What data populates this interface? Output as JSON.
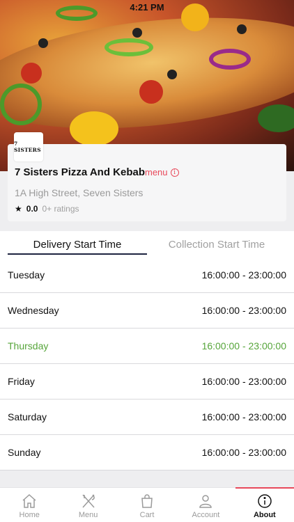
{
  "status_bar": {
    "time": "4:21 PM"
  },
  "restaurant": {
    "logo_text": "7 SISTERS",
    "name": "7 Sisters Pizza And Kebab",
    "menu_link": "menu",
    "address": "1A High Street, Seven Sisters",
    "rating_value": "0.0",
    "rating_count": "0+ ratings"
  },
  "tabs": {
    "delivery": "Delivery Start Time",
    "collection": "Collection Start Time"
  },
  "hours": [
    {
      "day": "Tuesday",
      "time": "16:00:00 - 23:00:00"
    },
    {
      "day": "Wednesday",
      "time": "16:00:00 - 23:00:00"
    },
    {
      "day": "Thursday",
      "time": "16:00:00 - 23:00:00"
    },
    {
      "day": "Friday",
      "time": "16:00:00 - 23:00:00"
    },
    {
      "day": "Saturday",
      "time": "16:00:00 - 23:00:00"
    },
    {
      "day": "Sunday",
      "time": "16:00:00 - 23:00:00"
    }
  ],
  "bottom_nav": {
    "home": "Home",
    "menu": "Menu",
    "cart": "Cart",
    "account": "Account",
    "about": "About"
  },
  "colors": {
    "accent": "#e8485a",
    "active_day": "#56a53a",
    "tab_underline": "#1d2340"
  }
}
